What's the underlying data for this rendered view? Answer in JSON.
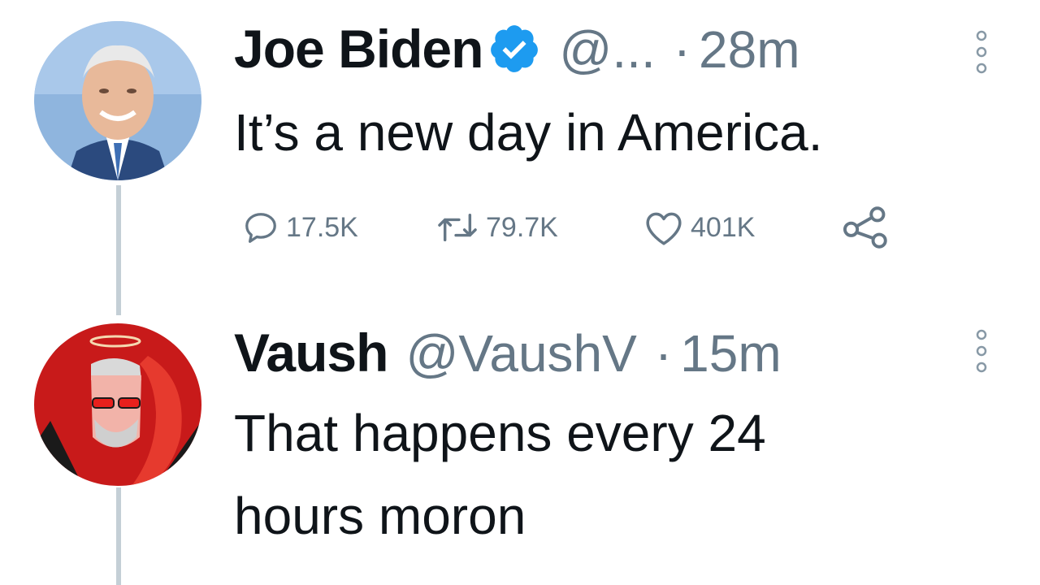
{
  "colors": {
    "verified_badge": "#1d9bf0",
    "secondary_text": "#657786",
    "thread_line": "#c4cfd6"
  },
  "tweets": [
    {
      "display_name": "Joe Biden",
      "verified": true,
      "handle": "@...",
      "separator": "·",
      "time": "28m",
      "text": "It’s a new day in America.",
      "stats": {
        "replies": "17.5K",
        "retweets": "79.7K",
        "likes": "401K"
      },
      "icons": [
        "reply-icon",
        "retweet-icon",
        "like-icon",
        "share-icon",
        "more-icon"
      ]
    },
    {
      "display_name": "Vaush",
      "verified": false,
      "handle": "@VaushV",
      "separator": "·",
      "time": "15m",
      "text_lines": [
        "That happens every 24",
        "hours moron"
      ],
      "icons": [
        "more-icon"
      ]
    }
  ]
}
